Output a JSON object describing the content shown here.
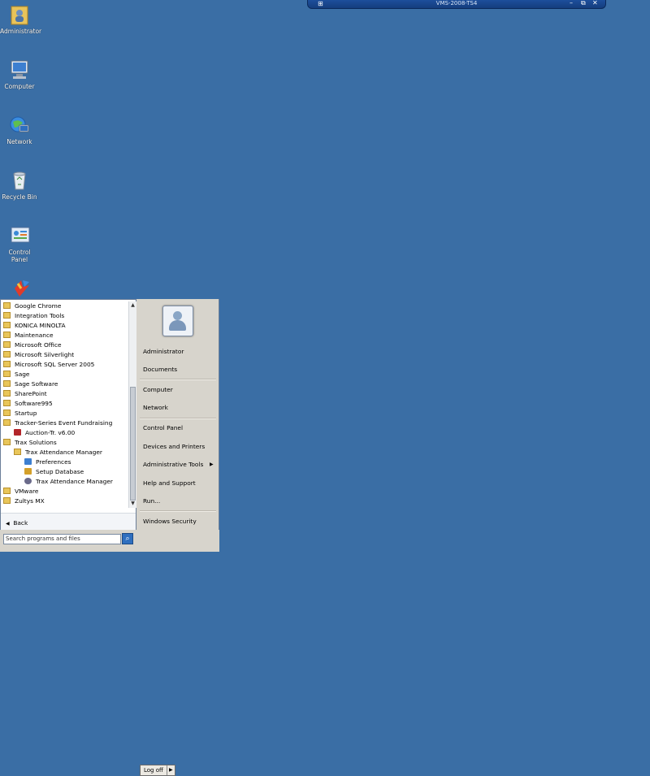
{
  "rdp_bar": {
    "title": "VMS-2008-TS4",
    "pin": "⊞",
    "minimize": "–",
    "restore": "⧉",
    "close": "✕"
  },
  "desktop_icons": [
    {
      "label": "Administrator"
    },
    {
      "label": "Computer"
    },
    {
      "label": "Network"
    },
    {
      "label": "Recycle Bin"
    },
    {
      "label": "Control Panel"
    }
  ],
  "start_menu": {
    "programs": [
      {
        "label": "Google Chrome",
        "indent": 0,
        "icon": "folder-icon"
      },
      {
        "label": "Integration Tools",
        "indent": 0,
        "icon": "folder-icon"
      },
      {
        "label": "KONICA MINOLTA",
        "indent": 0,
        "icon": "folder-icon"
      },
      {
        "label": "Maintenance",
        "indent": 0,
        "icon": "folder-icon"
      },
      {
        "label": "Microsoft Office",
        "indent": 0,
        "icon": "folder-icon"
      },
      {
        "label": "Microsoft Silverlight",
        "indent": 0,
        "icon": "folder-icon"
      },
      {
        "label": "Microsoft SQL Server 2005",
        "indent": 0,
        "icon": "folder-icon"
      },
      {
        "label": "Sage",
        "indent": 0,
        "icon": "folder-icon"
      },
      {
        "label": "Sage Software",
        "indent": 0,
        "icon": "folder-icon"
      },
      {
        "label": "SharePoint",
        "indent": 0,
        "icon": "folder-icon"
      },
      {
        "label": "Software995",
        "indent": 0,
        "icon": "folder-icon"
      },
      {
        "label": "Startup",
        "indent": 0,
        "icon": "folder-icon"
      },
      {
        "label": "Tracker-Series Event Fundraising",
        "indent": 0,
        "icon": "folder-icon"
      },
      {
        "label": "Auction-Tr. v6.00",
        "indent": 1,
        "icon": "auction-app-icon"
      },
      {
        "label": "Trax Solutions",
        "indent": 0,
        "icon": "folder-icon"
      },
      {
        "label": "Trax Attendance Manager",
        "indent": 1,
        "icon": "folder-icon"
      },
      {
        "label": "Preferences",
        "indent": 2,
        "icon": "preferences-icon"
      },
      {
        "label": "Setup Database",
        "indent": 2,
        "icon": "setup-database-icon"
      },
      {
        "label": "Trax Attendance Manager",
        "indent": 2,
        "icon": "trax-app-icon"
      },
      {
        "label": "VMware",
        "indent": 0,
        "icon": "folder-icon"
      },
      {
        "label": "Zultys MX",
        "indent": 0,
        "icon": "folder-icon"
      }
    ],
    "back_label": "Back",
    "search_placeholder": "Search programs and files",
    "right_items": {
      "administrator": "Administrator",
      "documents": "Documents",
      "computer": "Computer",
      "network": "Network",
      "control_panel": "Control Panel",
      "devices_printers": "Devices and Printers",
      "admin_tools": "Administrative Tools",
      "help_support": "Help and Support",
      "run": "Run...",
      "windows_security": "Windows Security"
    },
    "logoff_label": "Log off"
  },
  "colors": {
    "desktop": "#3a6ea5",
    "menu_right": "#d7d4cc",
    "folder": "#e9c65a"
  }
}
